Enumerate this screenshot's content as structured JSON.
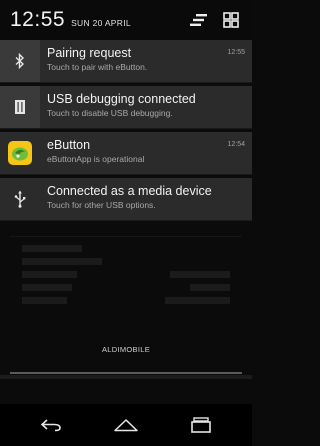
{
  "header": {
    "time": "12:55",
    "date": "SUN 20 APRIL",
    "settings_icon": "quick-settings-icon",
    "toggle_icon": "toggle-view-icon"
  },
  "notifications": [
    {
      "icon": "bluetooth-icon",
      "title": "Pairing request",
      "subtitle": "Touch to pair with eButton.",
      "time": "12:55"
    },
    {
      "icon": "usb-debug-icon",
      "title": "USB debugging connected",
      "subtitle": "Touch to disable USB debugging.",
      "time": ""
    },
    {
      "icon": "ebutton-app-icon",
      "title": "eButton",
      "subtitle": "eButtonApp is operational",
      "time": "12:54"
    },
    {
      "icon": "usb-icon",
      "title": "Connected as a media device",
      "subtitle": "Touch for other USB options.",
      "time": ""
    }
  ],
  "carrier": "ALDIMOBILE",
  "navbar": {
    "back_icon": "back-icon",
    "home_icon": "home-icon",
    "recents_icon": "recents-icon"
  },
  "colors": {
    "background": "#0b0b0b",
    "card": "#2b2b2b",
    "icon_box": "#3a3a3a",
    "ebutton_icon": "#f5c518"
  }
}
